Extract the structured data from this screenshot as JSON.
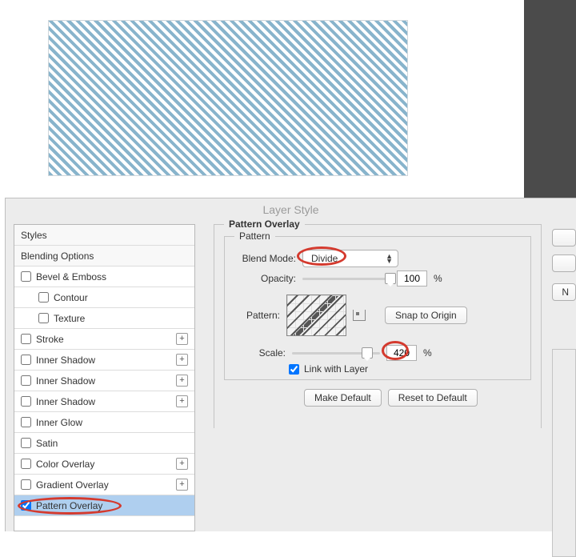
{
  "dialog": {
    "title": "Layer Style"
  },
  "style_list": [
    {
      "name": "Styles",
      "header": true
    },
    {
      "name": "Blending Options",
      "header": true
    },
    {
      "name": "Bevel & Emboss",
      "checkbox": true
    },
    {
      "name": "Contour",
      "checkbox": true,
      "indent": true
    },
    {
      "name": "Texture",
      "checkbox": true,
      "indent": true
    },
    {
      "name": "Stroke",
      "checkbox": true,
      "plus": true
    },
    {
      "name": "Inner Shadow",
      "checkbox": true,
      "plus": true
    },
    {
      "name": "Inner Shadow",
      "checkbox": true,
      "plus": true
    },
    {
      "name": "Inner Shadow",
      "checkbox": true,
      "plus": true
    },
    {
      "name": "Inner Glow",
      "checkbox": true
    },
    {
      "name": "Satin",
      "checkbox": true
    },
    {
      "name": "Color Overlay",
      "checkbox": true,
      "plus": true
    },
    {
      "name": "Gradient Overlay",
      "checkbox": true,
      "plus": true
    },
    {
      "name": "Pattern Overlay",
      "checkbox": true,
      "checked": true,
      "selected": true
    }
  ],
  "panel": {
    "title": "Pattern Overlay",
    "fieldset_title": "Pattern",
    "blend_mode_label": "Blend Mode:",
    "blend_mode_value": "Divide",
    "opacity_label": "Opacity:",
    "opacity_value": "100",
    "pattern_label": "Pattern:",
    "snap_to_origin": "Snap to Origin",
    "scale_label": "Scale:",
    "scale_value": "420",
    "link_label": "Link with Layer",
    "link_checked": true,
    "make_default": "Make Default",
    "reset_default": "Reset to Default",
    "percent": "%"
  }
}
